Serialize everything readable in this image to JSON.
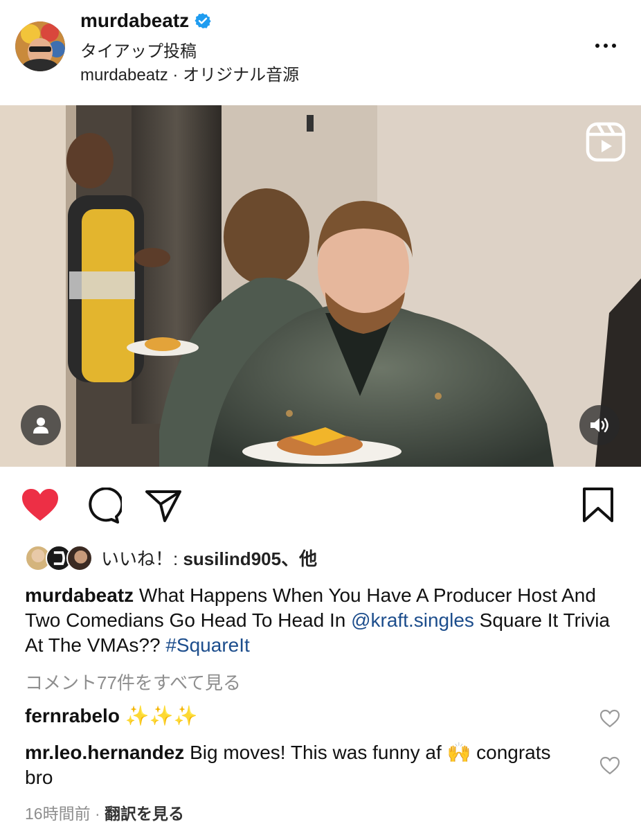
{
  "post": {
    "username": "murdabeatz",
    "tie_up_label": "タイアップ投稿",
    "audio_label": "murdabeatz · オリジナル音源"
  },
  "likes": {
    "prefix": "いいね！: ",
    "liker": "susilind905",
    "suffix": "、他"
  },
  "caption": {
    "username": "murdabeatz",
    "text_before": " What Happens When You Have A Producer Host And Two Comedians Go Head To Head In ",
    "mention": "@kraft.singles",
    "text_after": " Square It Trivia At The VMAs?? ",
    "hashtag": "#SquareIt"
  },
  "view_all_comments": "コメント77件をすべて見る",
  "comments": [
    {
      "username": "fernrabelo",
      "text": " ✨✨✨"
    },
    {
      "username": "mr.leo.hernandez",
      "text": " Big moves! This was funny af 🙌 congrats bro"
    }
  ],
  "meta": {
    "time": "16時間前",
    "separator": " · ",
    "translate": "翻訳を見る"
  },
  "colors": {
    "like_red": "#ed2f45",
    "verified_blue": "#1f9cf0",
    "link_blue": "#1c4d8c",
    "muted_gray": "#8e8e8e"
  },
  "icons": {
    "verified": "verified-badge-icon",
    "more": "more-options-icon",
    "reels": "reels-icon",
    "tag": "user-tag-icon",
    "sound": "volume-icon",
    "like": "heart-filled-icon",
    "comment": "comment-bubble-icon",
    "share": "paper-plane-icon",
    "save": "bookmark-icon",
    "comment_like": "heart-outline-icon"
  }
}
